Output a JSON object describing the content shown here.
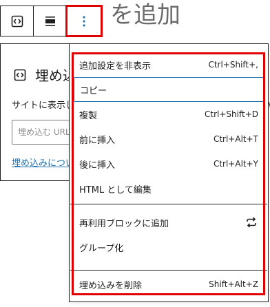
{
  "background": {
    "heading_fragment": "を追加"
  },
  "toolbar": {
    "buttons": [
      {
        "icon": "embed-icon"
      },
      {
        "icon": "align-icon"
      },
      {
        "icon": "more-options-icon"
      }
    ]
  },
  "embed_block": {
    "title": "埋め込み",
    "description": "サイトに表示したいコンテンツへのリンクを貼り付けてください。",
    "input_placeholder": "埋め込む URL をここに入力…",
    "learn_more_link": "埋め込みについてさらに詳しく"
  },
  "menu": {
    "items_group1": [
      {
        "label": "追加設定を非表示",
        "shortcut": "Ctrl+Shift+,"
      },
      {
        "label": "コピー",
        "shortcut": ""
      },
      {
        "label": "複製",
        "shortcut": "Ctrl+Shift+D"
      },
      {
        "label": "前に挿入",
        "shortcut": "Ctrl+Alt+T"
      },
      {
        "label": "後に挿入",
        "shortcut": "Ctrl+Alt+Y"
      },
      {
        "label": "HTML として編集",
        "shortcut": ""
      }
    ],
    "items_group2": [
      {
        "label": "再利用ブロックに追加",
        "icon": "reusable-icon"
      },
      {
        "label": "グループ化"
      }
    ],
    "items_group3": [
      {
        "label": "埋め込みを削除",
        "shortcut": "Shift+Alt+Z"
      }
    ]
  },
  "colors": {
    "highlight": "#e00000",
    "focus": "#2271b1",
    "link": "#2271b1"
  }
}
